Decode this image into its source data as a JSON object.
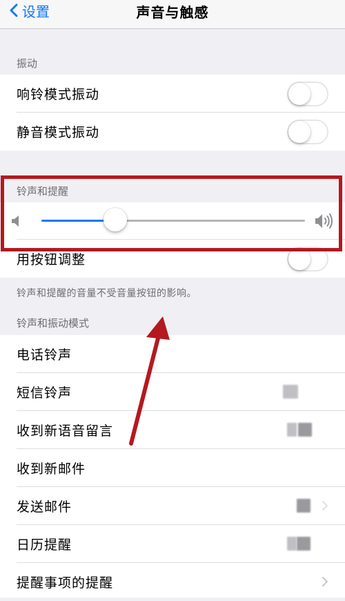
{
  "nav": {
    "back_label": "设置",
    "title": "声音与触感"
  },
  "sections": {
    "vibration_header": "振动",
    "ringer_header": "铃声和提醒",
    "ringtone_header": "铃声和振动模式"
  },
  "vibration": {
    "ring_mode": {
      "label": "响铃模式振动",
      "on": false
    },
    "silent_mode": {
      "label": "静音模式振动",
      "on": false
    }
  },
  "ringer": {
    "volume": 0.28,
    "change_with_buttons": {
      "label": "用按钮调整",
      "on": false
    },
    "footer_note": "铃声和提醒的音量不受音量按钮的影响。"
  },
  "ringtones": {
    "items": [
      {
        "label": "电话铃声"
      },
      {
        "label": "短信铃声"
      },
      {
        "label": "收到新语音留言"
      },
      {
        "label": "收到新邮件"
      },
      {
        "label": "发送邮件"
      },
      {
        "label": "日历提醒"
      },
      {
        "label": "提醒事项的提醒"
      }
    ]
  },
  "colors": {
    "accent": "#1478f6",
    "annotation_red": "#b3191f",
    "background": "#efeff4"
  },
  "icons": {
    "back": "chevron-left-icon",
    "volume_low": "speaker-low-icon",
    "volume_high": "speaker-high-icon",
    "disclosure": "chevron-right-icon"
  }
}
